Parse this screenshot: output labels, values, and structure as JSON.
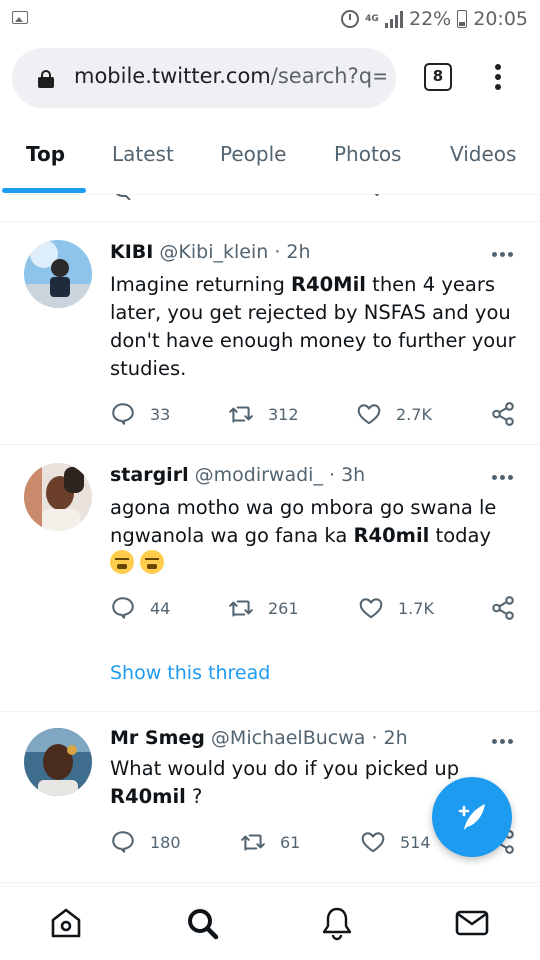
{
  "status_bar": {
    "network": "4G",
    "battery": "22%",
    "time": "20:05"
  },
  "browser": {
    "url_host": "mobile.twitter.com",
    "url_path": "/search?q=",
    "tab_count": "8"
  },
  "tabs": [
    {
      "label": "Top",
      "active": true
    },
    {
      "label": "Latest",
      "active": false
    },
    {
      "label": "People",
      "active": false
    },
    {
      "label": "Photos",
      "active": false
    },
    {
      "label": "Videos",
      "active": false
    }
  ],
  "tweets": [
    {
      "name": "KIBI",
      "handle": "@Kibi_klein",
      "time": "· 2h",
      "text_before": "Imagine returning ",
      "text_bold": "R40Mil",
      "text_after": " then 4 years later, you get rejected by NSFAS and you don't have enough money to further your studies.",
      "replies": "33",
      "retweets": "312",
      "likes": "2.7K"
    },
    {
      "name": "stargirl",
      "handle": "@modirwadi_",
      "time": "· 3h",
      "text_before": "agona motho wa go mbora go swana le ngwanola wa go fana ka ",
      "text_bold": "R40mil",
      "text_after": " today ",
      "emoji": "😤",
      "replies": "44",
      "retweets": "261",
      "likes": "1.7K",
      "show_thread": "Show this thread"
    },
    {
      "name": "Mr Smeg",
      "handle": "@MichaelBucwa",
      "time": "· 2h",
      "text_before": "What would you do if you picked up ",
      "text_bold": "R40mil",
      "text_after": " ?",
      "replies": "180",
      "retweets": "61",
      "likes": "514"
    }
  ],
  "icons": {
    "reply": "reply-icon",
    "retweet": "retweet-icon",
    "like": "heart-icon",
    "share": "share-icon",
    "compose": "compose-tweet-icon",
    "home": "home-icon",
    "search": "search-icon",
    "notifications": "bell-icon",
    "messages": "mail-icon"
  },
  "colors": {
    "accent": "#1d9bf0",
    "text": "#0f1419",
    "muted": "#536471"
  }
}
